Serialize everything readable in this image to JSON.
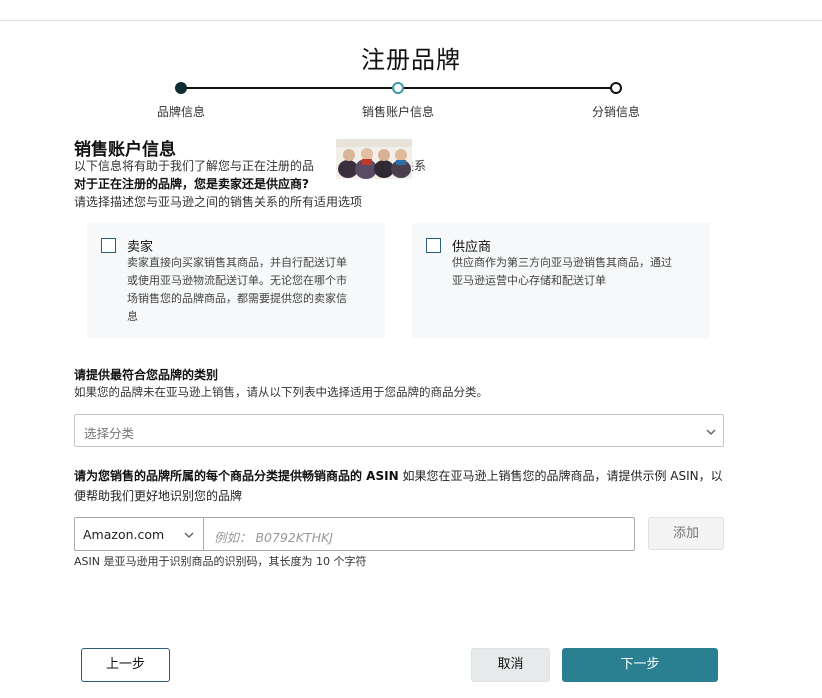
{
  "page": {
    "title": "注册品牌"
  },
  "stepper": {
    "steps": [
      {
        "label": "品牌信息",
        "state": "complete"
      },
      {
        "label": "销售账户信息",
        "state": "active"
      },
      {
        "label": "分销信息",
        "state": "pending"
      }
    ]
  },
  "sales_account": {
    "section_title": "销售账户信息",
    "intro_text_before": "以下信息将有助于我们了解您与正在注册的品",
    "intro_text_after": "间的关系",
    "question": "对于正在注册的品牌，您是卖家还是供应商?",
    "question_hint": "请选择描述您与亚马逊之间的销售关系的所有适用选项"
  },
  "options": [
    {
      "title": "卖家",
      "checked": false,
      "description_lines": [
        "卖家直接向买家销售其商品，并自行配送订单",
        "或使用亚马逊物流配送订单。无论您在哪个市",
        "场销售您的品牌商品，都需要提供您的卖家信",
        "息"
      ]
    },
    {
      "title": "供应商",
      "checked": false,
      "description_lines": [
        "供应商作为第三方向亚马逊销售其商品，通过",
        "亚马逊运营中心存储和配送订单"
      ]
    }
  ],
  "category": {
    "title": "请提供最符合您品牌的类别",
    "hint": "如果您的品牌未在亚马逊上销售，请从以下列表中选择适用于您品牌的商品分类。",
    "select_placeholder": "选择分类"
  },
  "asin": {
    "title_bold": "请为您销售的品牌所属的每个商品分类提供畅销商品的 ASIN",
    "title_rest": " 如果您在亚马逊上销售您的品牌商品，请提供示例 ASIN，以便帮助我们更好地识别您的品牌",
    "marketplace_value": "Amazon.com",
    "input_placeholder": "例如： B0792KTHKJ",
    "add_button": "添加",
    "help_text": "ASIN 是亚马逊用于识别商品的识别码，其长度为 10 个字符"
  },
  "footer": {
    "prev_button": "上一步",
    "cancel_button": "取消",
    "next_button": "下一步"
  },
  "colors": {
    "accent": "#2a7f90",
    "step_active": "#3b9aa6",
    "step_done": "#0f2b33",
    "checkbox_border": "#2a5d78"
  }
}
